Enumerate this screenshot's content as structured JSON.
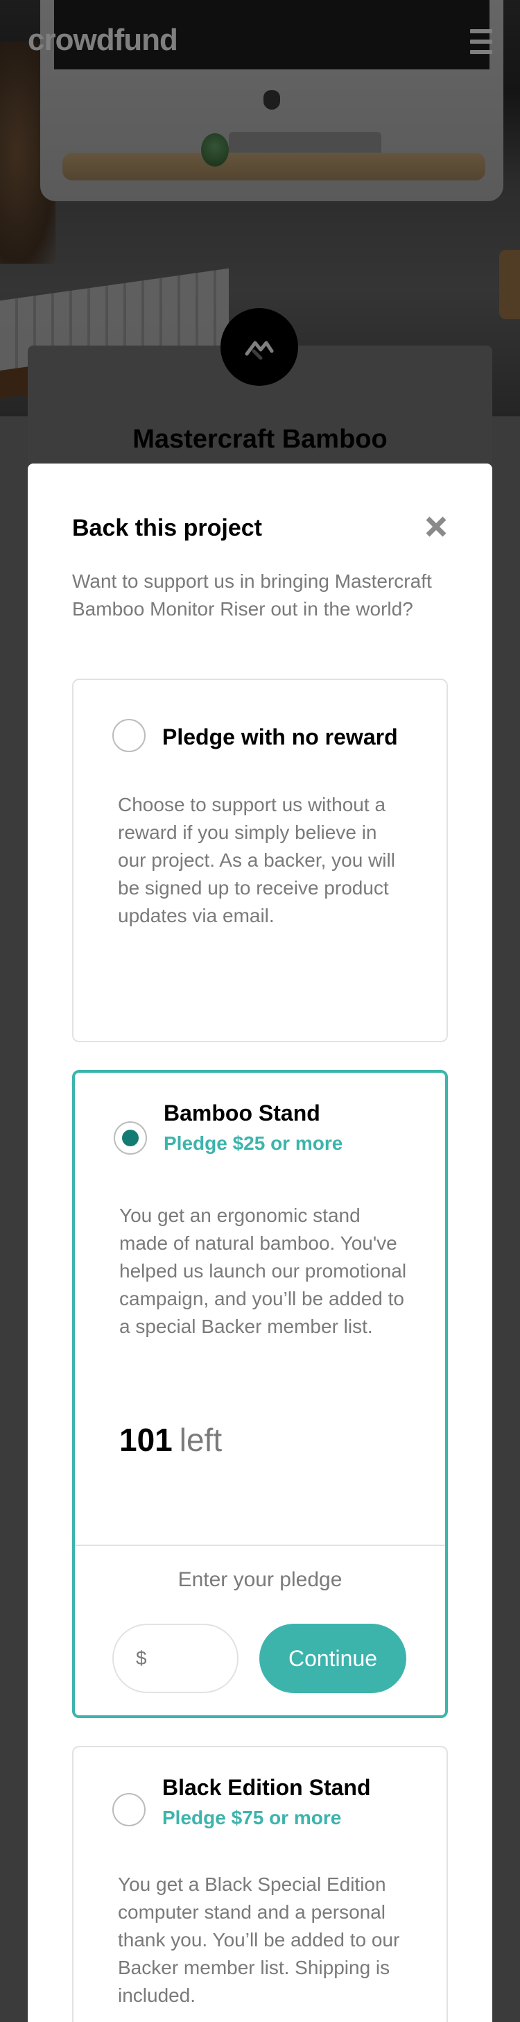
{
  "header": {
    "brand": "crowdfund"
  },
  "project": {
    "title": "Mastercraft Bamboo"
  },
  "modal": {
    "title": "Back this project",
    "intro": "Want to support us in bringing Mastercraft Bamboo Monitor Riser out in the world?",
    "pledges": [
      {
        "name": "Pledge with no reward",
        "minimum": "",
        "description": "Choose to support us without a reward if you simply believe in our project. As a backer, you will be signed up to receive product updates via email.",
        "selected": false
      },
      {
        "name": "Bamboo Stand",
        "minimum": "Pledge $25 or more",
        "description": "You get an ergonomic stand made of natural bamboo. You've helped us launch our promotional campaign, and you’ll be added to a special Backer member list.",
        "left_count": "101",
        "left_label": "left",
        "selected": true,
        "enter_label": "Enter your pledge",
        "currency": "$",
        "amount_value": "",
        "continue_label": "Continue"
      },
      {
        "name": "Black Edition Stand",
        "minimum": "Pledge $75 or more",
        "description": "You get a Black Special Edition computer stand and a personal thank you. You’ll be added to our Backer member list. Shipping is included.",
        "selected": false
      }
    ]
  },
  "colors": {
    "accent": "#3cb4ac",
    "accent_dark": "#147b74",
    "overlay": "rgba(0,0,0,0.5)"
  }
}
